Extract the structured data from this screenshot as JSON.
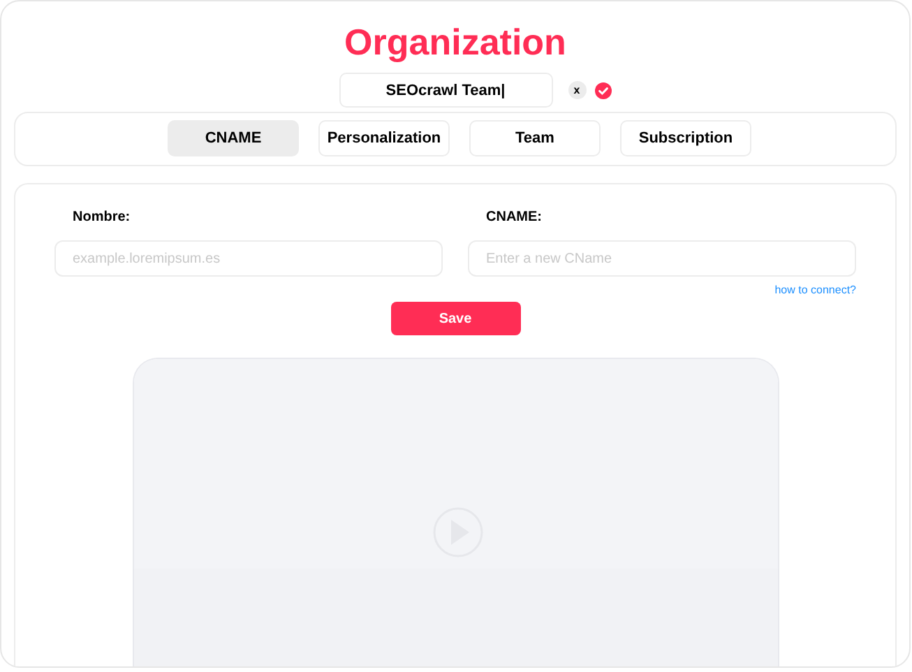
{
  "title": "Organization",
  "name_field": {
    "value": "SEOcrawl Team|"
  },
  "clear_button": {
    "label": "x"
  },
  "tabs": [
    {
      "label": "CNAME",
      "selected": true
    },
    {
      "label": "Personalization",
      "selected": false
    },
    {
      "label": "Team",
      "selected": false
    },
    {
      "label": "Subscription",
      "selected": false
    }
  ],
  "form": {
    "fields": [
      {
        "label": "Nombre:",
        "placeholder": "example.loremipsum.es"
      },
      {
        "label": "CNAME:",
        "placeholder": "Enter a new CName"
      }
    ],
    "help_link": "how to connect?",
    "save_button": "Save"
  }
}
